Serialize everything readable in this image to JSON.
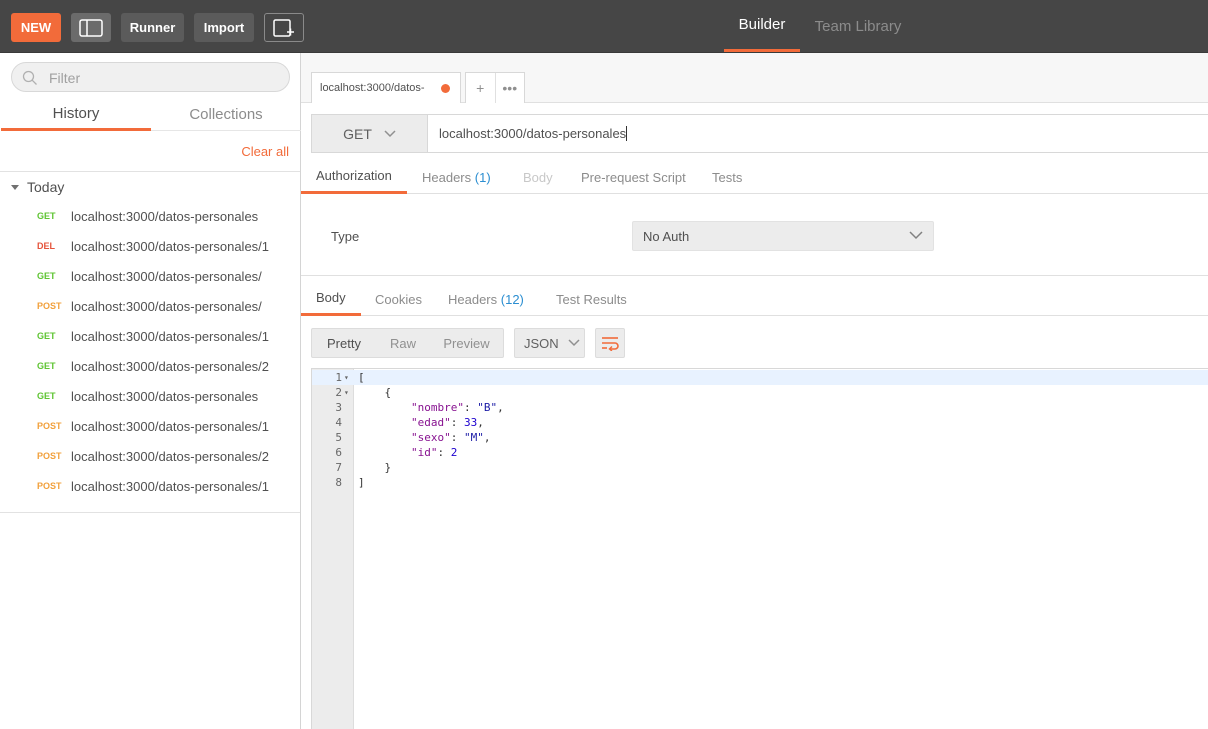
{
  "topbar": {
    "new_label": "NEW",
    "runner_label": "Runner",
    "import_label": "Import",
    "tabs": {
      "builder": "Builder",
      "team_library": "Team Library"
    }
  },
  "colors": {
    "accent": "#f26b3a",
    "get": "#5fc433",
    "delete": "#e5533b",
    "post": "#f2a03b",
    "count": "#2b8ed1"
  },
  "sidebar": {
    "filter_placeholder": "Filter",
    "tabs": {
      "history": "History",
      "collections": "Collections"
    },
    "clear_all": "Clear all",
    "group_label": "Today",
    "history": [
      {
        "method": "GET",
        "url": "localhost:3000/datos-personales"
      },
      {
        "method": "DEL",
        "url": "localhost:3000/datos-personales/1"
      },
      {
        "method": "GET",
        "url": "localhost:3000/datos-personales/"
      },
      {
        "method": "POST",
        "url": "localhost:3000/datos-personales/"
      },
      {
        "method": "GET",
        "url": "localhost:3000/datos-personales/1"
      },
      {
        "method": "GET",
        "url": "localhost:3000/datos-personales/2"
      },
      {
        "method": "GET",
        "url": "localhost:3000/datos-personales"
      },
      {
        "method": "POST",
        "url": "localhost:3000/datos-personales/1"
      },
      {
        "method": "POST",
        "url": "localhost:3000/datos-personales/2"
      },
      {
        "method": "POST",
        "url": "localhost:3000/datos-personales/1"
      }
    ]
  },
  "request": {
    "tab_title": "localhost:3000/datos-",
    "add_tab": "+",
    "more_tabs": "•••",
    "method": "GET",
    "url": "localhost:3000/datos-personales",
    "tabs": {
      "authorization": "Authorization",
      "headers": "Headers",
      "headers_count": "(1)",
      "body": "Body",
      "pre_request": "Pre-request Script",
      "tests": "Tests"
    },
    "auth": {
      "type_label": "Type",
      "type_value": "No Auth"
    }
  },
  "response": {
    "tabs": {
      "body": "Body",
      "cookies": "Cookies",
      "headers": "Headers",
      "headers_count": "(12)",
      "test_results": "Test Results"
    },
    "view": {
      "pretty": "Pretty",
      "raw": "Raw",
      "preview": "Preview"
    },
    "format": "JSON",
    "line_numbers": [
      "1",
      "2",
      "3",
      "4",
      "5",
      "6",
      "7",
      "8"
    ],
    "code": {
      "l1": "[",
      "l2": "    {",
      "l3_key": "\"nombre\"",
      "l3_val": "\"B\"",
      "l4_key": "\"edad\"",
      "l4_val": "33",
      "l5_key": "\"sexo\"",
      "l5_val": "\"M\"",
      "l6_key": "\"id\"",
      "l6_val": "2",
      "l7": "    }",
      "l8": "]"
    }
  }
}
